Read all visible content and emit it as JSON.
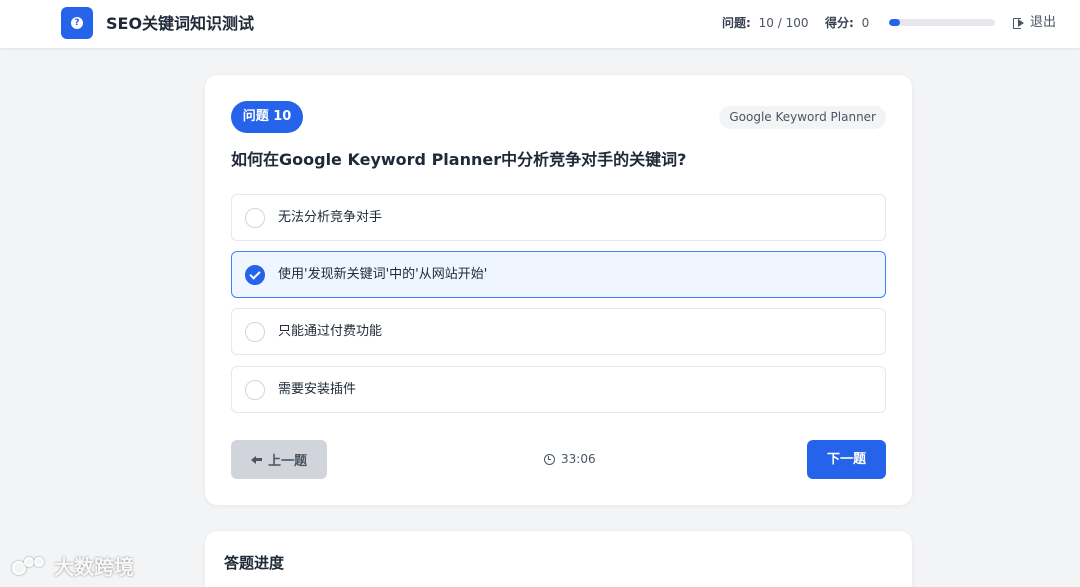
{
  "header": {
    "logo_glyph": "?",
    "title": "SEO关键词知识测试",
    "question_label": "问题:",
    "question_value": "10 / 100",
    "score_label": "得分:",
    "score_value": "0",
    "progress_fraction": 0.1,
    "exit_label": "退出"
  },
  "question": {
    "badge": "问题 10",
    "category": "Google Keyword Planner",
    "text": "如何在Google Keyword Planner中分析竞争对手的关键词?",
    "options": [
      {
        "label": "无法分析竞争对手",
        "selected": false
      },
      {
        "label": "使用'发现新关键词'中的'从网站开始'",
        "selected": true
      },
      {
        "label": "只能通过付费功能",
        "selected": false
      },
      {
        "label": "需要安装插件",
        "selected": false
      }
    ]
  },
  "nav": {
    "prev_label": "上一题",
    "timer": "33:06",
    "next_label": "下一题"
  },
  "progress_section": {
    "title": "答题进度"
  },
  "watermark": {
    "text": "大数跨境"
  },
  "colors": {
    "accent": "#2563eb",
    "selected_bg": "#eff6ff",
    "page_bg": "#f3f4f6"
  }
}
